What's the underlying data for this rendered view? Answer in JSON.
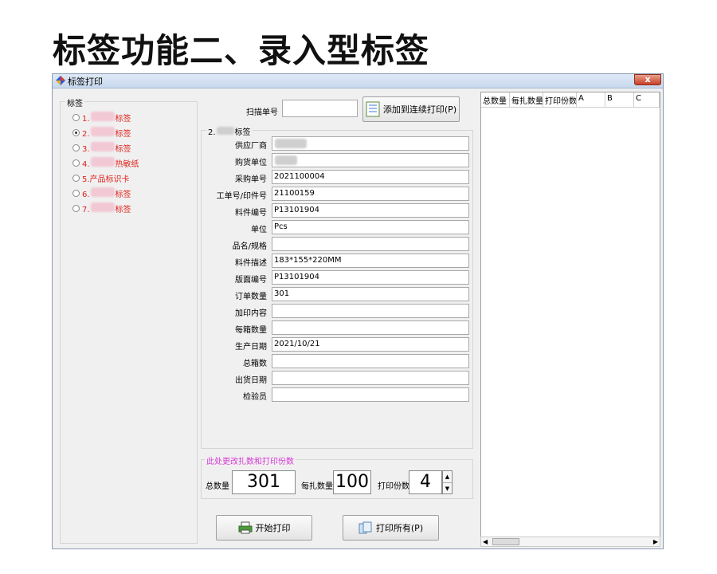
{
  "page": {
    "heading": "标签功能二、录入型标签"
  },
  "window": {
    "title": "标签打印",
    "close_label": "x"
  },
  "label_group": {
    "legend": "标签",
    "options": [
      {
        "prefix": "1.",
        "suffix": "标签",
        "checked": false
      },
      {
        "prefix": "2.",
        "suffix": "标签",
        "checked": true
      },
      {
        "prefix": "3.",
        "suffix": "标签",
        "checked": false
      },
      {
        "prefix": "4.",
        "suffix": "热敏纸",
        "checked": false
      },
      {
        "prefix": "5.产品标识卡",
        "suffix": "",
        "checked": false
      },
      {
        "prefix": "6.",
        "suffix": "标签",
        "checked": false
      },
      {
        "prefix": "7.",
        "suffix": "标签",
        "checked": false
      }
    ]
  },
  "scan": {
    "label": "扫描单号",
    "value": "",
    "add_button": "添加到连续打印(P)"
  },
  "form": {
    "legend_prefix": "2.",
    "legend_suffix": "标签",
    "fields": [
      {
        "label": "供应厂商",
        "value": ""
      },
      {
        "label": "购货单位",
        "value": ""
      },
      {
        "label": "采购单号",
        "value": "2021100004"
      },
      {
        "label": "工单号/印件号",
        "value": "21100159"
      },
      {
        "label": "料件编号",
        "value": "P13101904"
      },
      {
        "label": "单位",
        "value": "Pcs"
      },
      {
        "label": "品名/规格",
        "value": ""
      },
      {
        "label": "料件描述",
        "value": "183*155*220MM"
      },
      {
        "label": "版面编号",
        "value": "P13101904"
      },
      {
        "label": "订单数量",
        "value": "301"
      },
      {
        "label": "加印内容",
        "value": ""
      },
      {
        "label": "每箱数量",
        "value": ""
      },
      {
        "label": "生产日期",
        "value": "2021/10/21"
      },
      {
        "label": "总箱数",
        "value": ""
      },
      {
        "label": "出货日期",
        "value": ""
      },
      {
        "label": "检验员",
        "value": ""
      }
    ]
  },
  "quantity": {
    "hint": "此处更改扎数和打印份数",
    "total_label": "总数量",
    "total_value": "301",
    "per_bundle_label": "每扎数量",
    "per_bundle_value": "100",
    "copies_label": "打印份数",
    "copies_value": "4"
  },
  "actions": {
    "start_print": "开始打印",
    "print_all": "打印所有(P)"
  },
  "grid": {
    "columns": [
      "总数量",
      "每扎数量",
      "打印份数",
      "A",
      "B",
      "C"
    ]
  },
  "colors": {
    "accent_red": "#e0221a",
    "hint_pink": "#d63ad6"
  }
}
